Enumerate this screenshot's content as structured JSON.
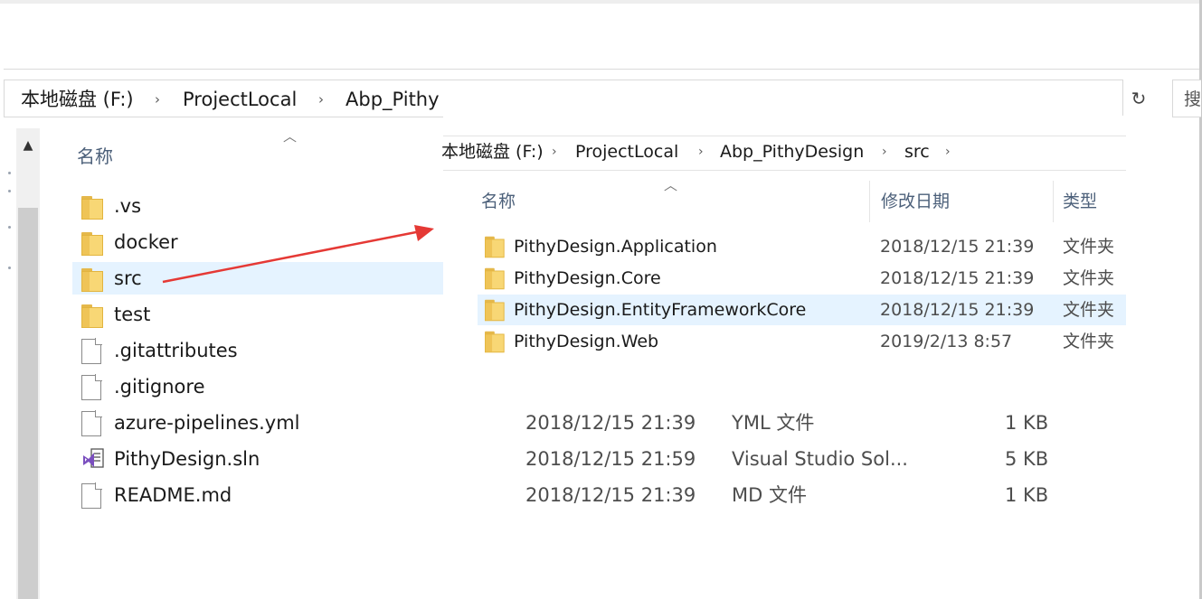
{
  "back_window": {
    "breadcrumb": [
      "本地磁盘 (F:)",
      "ProjectLocal",
      "Abp_Pithy"
    ],
    "refresh_glyph": "↻",
    "search_glyph": "搜",
    "column_header": "名称",
    "items": [
      {
        "name": ".vs",
        "icon": "folder-icon"
      },
      {
        "name": "docker",
        "icon": "folder-icon"
      },
      {
        "name": "src",
        "icon": "folder-icon",
        "selected": true
      },
      {
        "name": "test",
        "icon": "folder-icon"
      },
      {
        "name": ".gitattributes",
        "icon": "file-icon"
      },
      {
        "name": ".gitignore",
        "icon": "file-icon"
      },
      {
        "name": "azure-pipelines.yml",
        "icon": "file-icon",
        "date": "2018/12/15 21:39",
        "type": "YML 文件",
        "size": "1 KB"
      },
      {
        "name": "PithyDesign.sln",
        "icon": "visual-studio-solution-icon",
        "date": "2018/12/15 21:59",
        "type": "Visual Studio Sol...",
        "size": "5 KB"
      },
      {
        "name": "README.md",
        "icon": "file-icon",
        "date": "2018/12/15 21:39",
        "type": "MD 文件",
        "size": "1 KB"
      }
    ]
  },
  "front_window": {
    "breadcrumb": [
      "本地磁盘 (F:)",
      "ProjectLocal",
      "Abp_PithyDesign",
      "src"
    ],
    "columns": {
      "name": "名称",
      "date": "修改日期",
      "type": "类型"
    },
    "items": [
      {
        "name": "PithyDesign.Application",
        "date": "2018/12/15 21:39",
        "type": "文件夹"
      },
      {
        "name": "PithyDesign.Core",
        "date": "2018/12/15 21:39",
        "type": "文件夹"
      },
      {
        "name": "PithyDesign.EntityFrameworkCore",
        "date": "2018/12/15 21:39",
        "type": "文件夹",
        "selected": true
      },
      {
        "name": "PithyDesign.Web",
        "date": "2019/2/13 8:57",
        "type": "文件夹"
      }
    ]
  },
  "colors": {
    "selection": "#e5f3ff",
    "header_text": "#4c607a",
    "arrow": "#e53935",
    "folder": "#f8d775"
  }
}
